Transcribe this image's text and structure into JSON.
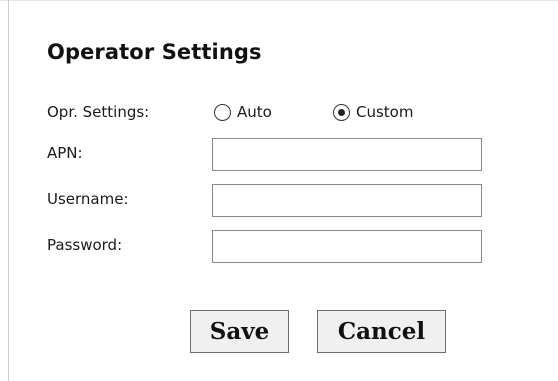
{
  "form": {
    "title": "Operator Settings",
    "opr_settings": {
      "label": "Opr. Settings:",
      "options": [
        {
          "label": "Auto",
          "selected": false
        },
        {
          "label": "Custom",
          "selected": true
        }
      ]
    },
    "apn": {
      "label": "APN:",
      "value": ""
    },
    "username": {
      "label": "Username:",
      "value": ""
    },
    "password": {
      "label": "Password:",
      "value": ""
    }
  },
  "buttons": {
    "save_label": "Save",
    "cancel_label": "Cancel"
  }
}
